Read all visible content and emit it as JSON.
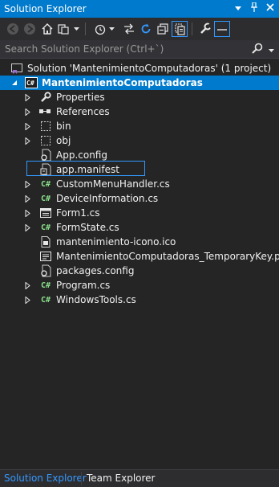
{
  "window": {
    "title": "Solution Explorer",
    "title_buttons": [
      "dropdown-icon",
      "pin-icon",
      "close-icon"
    ]
  },
  "toolbar": {
    "buttons": [
      "back-icon",
      "forward-icon",
      "home-icon",
      "switch-views-icon",
      "dropdown-icon",
      "pending-changes-icon",
      "dropdown-icon",
      "sync-icon",
      "refresh-icon",
      "collapse-all-icon",
      "show-all-files-icon",
      "properties-icon",
      "preview-icon"
    ]
  },
  "search": {
    "placeholder": "Search Solution Explorer (Ctrl+`)"
  },
  "tree": {
    "solution": "Solution 'MantenimientoComputadoras' (1 project)",
    "project": "MantenimientoComputadoras",
    "items": [
      {
        "label": "Properties",
        "icon": "wrench-icon",
        "expandable": true
      },
      {
        "label": "References",
        "icon": "references-icon",
        "expandable": true
      },
      {
        "label": "bin",
        "icon": "folder-icon",
        "expandable": true
      },
      {
        "label": "obj",
        "icon": "folder-icon",
        "expandable": true
      },
      {
        "label": "App.config",
        "icon": "config-file-icon",
        "expandable": false
      },
      {
        "label": "app.manifest",
        "icon": "manifest-file-icon",
        "expandable": false
      },
      {
        "label": "CustomMenuHandler.cs",
        "icon": "csharp-file-icon",
        "expandable": true
      },
      {
        "label": "DeviceInformation.cs",
        "icon": "csharp-file-icon",
        "expandable": true
      },
      {
        "label": "Form1.cs",
        "icon": "form-file-icon",
        "expandable": true
      },
      {
        "label": "FormState.cs",
        "icon": "csharp-file-icon",
        "expandable": true
      },
      {
        "label": "mantenimiento-icono.ico",
        "icon": "ico-file-icon",
        "expandable": false
      },
      {
        "label": "MantenimientoComputadoras_TemporaryKey.pfx",
        "icon": "certificate-file-icon",
        "expandable": false
      },
      {
        "label": "packages.config",
        "icon": "config-file-icon",
        "expandable": false
      },
      {
        "label": "Program.cs",
        "icon": "csharp-file-icon",
        "expandable": true
      },
      {
        "label": "WindowsTools.cs",
        "icon": "csharp-file-icon",
        "expandable": true
      }
    ]
  },
  "bottom_tabs": {
    "active": "Solution Explorer",
    "inactive": "Team Explorer"
  },
  "colors": {
    "accent": "#007acc",
    "background": "#252526",
    "focus_border": "#3399ff",
    "csharp_icon": "#8ae28a"
  }
}
